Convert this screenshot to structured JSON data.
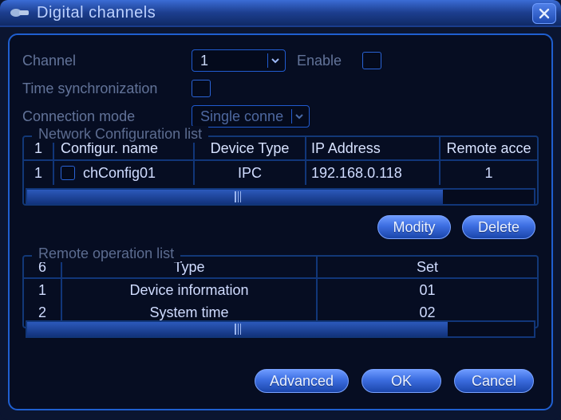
{
  "title": "Digital channels",
  "labels": {
    "channel": "Channel",
    "enable": "Enable",
    "timesync": "Time synchronization",
    "connmode": "Connection mode",
    "netlist": "Network Configuration list",
    "remotelist": "Remote operation list"
  },
  "channel": {
    "value": "1"
  },
  "connection_mode": {
    "value": "Single conne"
  },
  "network_list": {
    "count_header": "1",
    "columns": [
      "Configur. name",
      "Device Type",
      "IP Address",
      "Remote acce"
    ],
    "rows": [
      {
        "idx": "1",
        "name": "chConfig01",
        "type": "IPC",
        "ip": "192.168.0.118",
        "remote": "1"
      }
    ]
  },
  "remote_list": {
    "count_header": "6",
    "columns": [
      "Type",
      "Set"
    ],
    "rows": [
      {
        "idx": "1",
        "type": "Device information",
        "set": "01"
      },
      {
        "idx": "2",
        "type": "System time",
        "set": "02"
      }
    ]
  },
  "buttons": {
    "modify": "Modity",
    "delete": "Delete",
    "advanced": "Advanced",
    "ok": "OK",
    "cancel": "Cancel"
  }
}
